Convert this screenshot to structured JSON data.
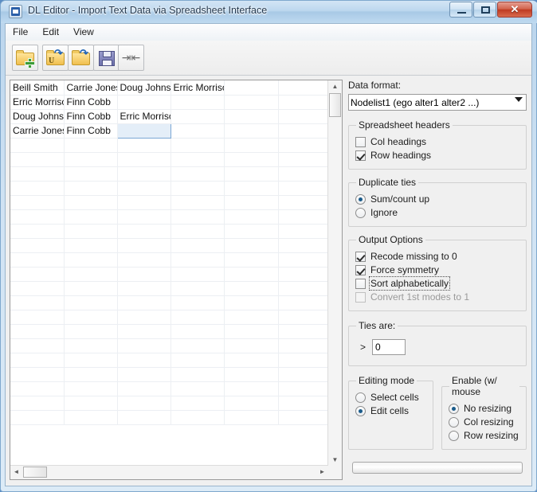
{
  "window": {
    "title": "DL Editor - Import Text Data via Spreadsheet Interface",
    "icon": "dl-editor-icon",
    "controls": {
      "minimize": "–",
      "maximize": "□",
      "close": "✕"
    }
  },
  "menubar": {
    "items": [
      {
        "label": "File"
      },
      {
        "label": "Edit"
      },
      {
        "label": "View"
      }
    ]
  },
  "toolbar": {
    "buttons": [
      {
        "name": "open-new-file-button",
        "icon": "folder-plus-icon"
      },
      {
        "name": "open-ucinet-file-button",
        "icon": "folder-u-arrow-icon"
      },
      {
        "name": "open-file-button",
        "icon": "folder-arrow-icon"
      },
      {
        "name": "save-file-button",
        "icon": "floppy-disk-icon"
      },
      {
        "name": "fit-columns-button",
        "icon": "collapse-arrows-icon"
      }
    ]
  },
  "spreadsheet": {
    "rows": [
      [
        "Beill Smith",
        "Carrie Jones",
        "Doug Johnso",
        "Erric Morriso",
        "",
        ""
      ],
      [
        "Erric Morriso",
        "Finn Cobb",
        "",
        "",
        "",
        ""
      ],
      [
        "Doug Johnso",
        "Finn Cobb",
        "Erric Morriso",
        "",
        "",
        ""
      ],
      [
        "Carrie Jones",
        "Finn Cobb",
        "",
        "",
        "",
        ""
      ]
    ],
    "empty_row_count": 20,
    "column_count": 6,
    "selected_cell": {
      "row": 3,
      "col": 2
    },
    "scroll": {
      "vertical_arrow_up": "▲",
      "vertical_arrow_down": "▼",
      "horizontal_arrow_left": "◄",
      "horizontal_arrow_right": "►"
    }
  },
  "panel": {
    "data_format": {
      "label": "Data format:",
      "selected": "Nodelist1 (ego alter1 alter2 ...)",
      "options": [
        "Nodelist1 (ego alter1 alter2 ...)"
      ]
    },
    "spreadsheet_headers": {
      "legend": "Spreadsheet headers",
      "items": [
        {
          "label": "Col headings",
          "checked": false
        },
        {
          "label": "Row headings",
          "checked": true
        }
      ]
    },
    "duplicate_ties": {
      "legend": "Duplicate ties",
      "items": [
        {
          "label": "Sum/count up",
          "selected": true
        },
        {
          "label": "Ignore",
          "selected": false
        }
      ]
    },
    "output_options": {
      "legend": "Output Options",
      "items": [
        {
          "label": "Recode missing to 0",
          "checked": true,
          "disabled": false,
          "focused": false
        },
        {
          "label": "Force symmetry",
          "checked": true,
          "disabled": false,
          "focused": false
        },
        {
          "label": "Sort alphabetically",
          "checked": false,
          "disabled": false,
          "focused": true
        },
        {
          "label": "Convert 1st modes to 1",
          "checked": false,
          "disabled": true,
          "focused": false
        }
      ]
    },
    "ties_are": {
      "legend": "Ties are:",
      "operator": ">",
      "value": "0"
    },
    "editing_mode": {
      "legend": "Editing mode",
      "items": [
        {
          "label": "Select cells",
          "selected": false
        },
        {
          "label": "Edit cells",
          "selected": true
        }
      ]
    },
    "enable_mouse": {
      "legend": "Enable (w/ mouse",
      "items": [
        {
          "label": "No resizing",
          "selected": true
        },
        {
          "label": "Col resizing",
          "selected": false
        },
        {
          "label": "Row resizing",
          "selected": false
        }
      ]
    },
    "progress": {
      "name": "progress-bar",
      "value": 0
    }
  },
  "colors": {
    "accent": "#1a5b8a",
    "selection": "#e4eef8",
    "selection_border": "#7aa7d4",
    "close_button": "#bf3b22"
  }
}
